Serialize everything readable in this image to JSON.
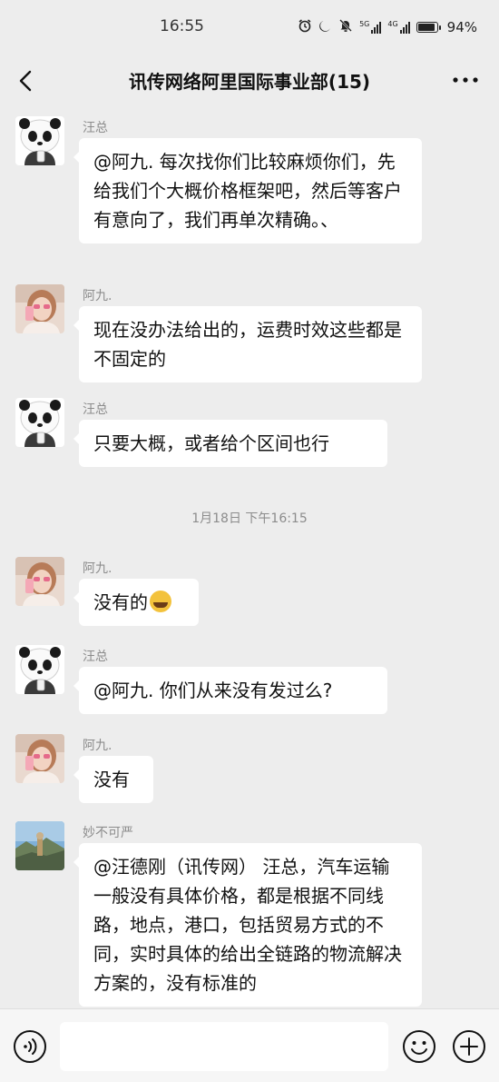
{
  "status": {
    "time": "16:55",
    "battery": "94%",
    "net1": "5G",
    "net2": "4G"
  },
  "nav": {
    "title": "讯传网络阿里国际事业部(15)"
  },
  "messages": [
    {
      "sender": "汪总",
      "avatar": "panda-avatar",
      "text": "@阿九. 每次找你们比较麻烦你们，先给我们个大概价格框架吧，然后等客户有意向了，我们再单次精确。、"
    },
    {
      "sender": "阿九.",
      "avatar": "girl-avatar",
      "text": "现在没办法给出的，运费时效这些都是不固定的"
    },
    {
      "sender": "汪总",
      "avatar": "panda-avatar",
      "text": "只要大概，或者给个区间也行"
    },
    {
      "sender": "阿九.",
      "avatar": "girl-avatar",
      "text": "没有的",
      "emoji": "laughing-crying-emoji"
    },
    {
      "sender": "汪总",
      "avatar": "panda-avatar",
      "text": "@阿九. 你们从来没有发过么?"
    },
    {
      "sender": "阿九.",
      "avatar": "girl-avatar",
      "text": "没有"
    },
    {
      "sender": "妙不可严",
      "avatar": "landscape-avatar",
      "text": "@汪德刚（讯传网） 汪总，汽车运输一般没有具体价格，都是根据不同线路，地点，港口，包括贸易方式的不同，实时具体的给出全链路的物流解决方案的，没有标准的"
    }
  ],
  "timestamp": "1月18日 下午16:15",
  "input": {
    "placeholder": ""
  },
  "colors": {
    "background": "#ededed",
    "bubble": "#ffffff",
    "meta_text": "#8c8c8c"
  }
}
